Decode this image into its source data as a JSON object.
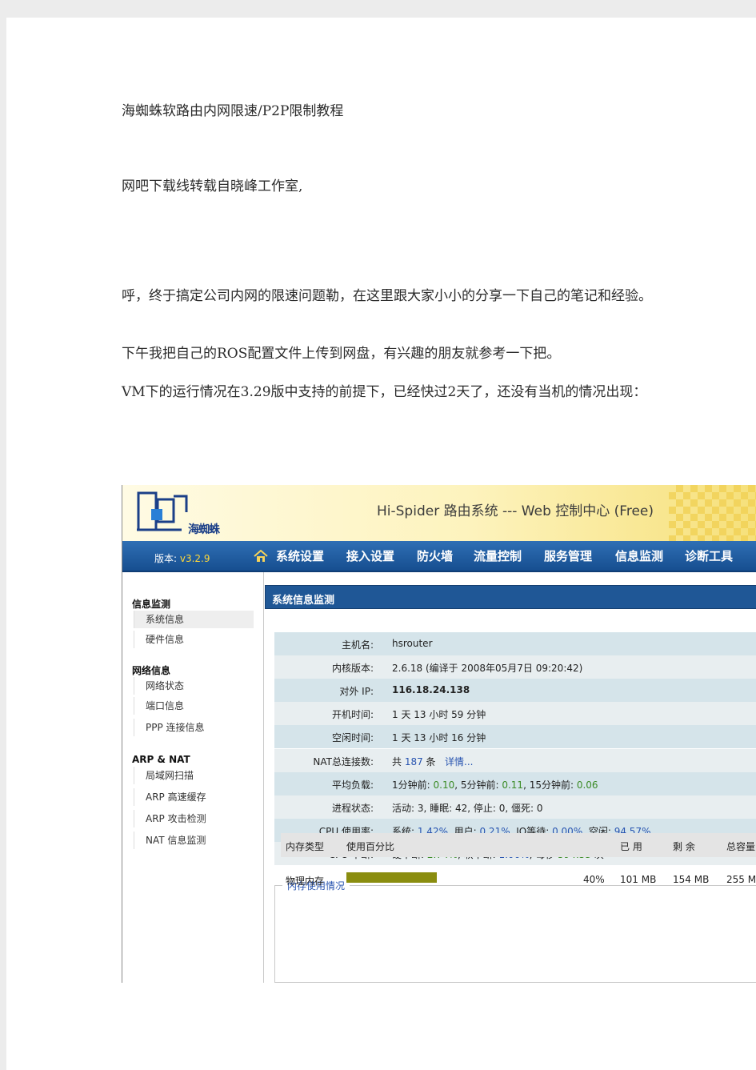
{
  "document": {
    "title": "海蜘蛛软路由内网限速/P2P限制教程",
    "source": "网吧下载线转载自晓峰工作室,",
    "para1": "呼，终于搞定公司内网的限速问题勒，在这里跟大家小小的分享一下自己的笔记和经验。",
    "para2": "下午我把自己的ROS配置文件上传到网盘，有兴趣的朋友就参考一下把。",
    "para3": "VM下的运行情况在3.29版中支持的前提下，已经快过2天了，还没有当机的情况出现："
  },
  "app": {
    "banner_title": "Hi-Spider 路由系统 --- Web 控制中心 (Free)",
    "logo_text": "海蜘蛛",
    "version_label": "版本: ",
    "version_value": "v3.2.9",
    "nav": [
      "系统设置",
      "接入设置",
      "防火墙",
      "流量控制",
      "服务管理",
      "信息监测",
      "诊断工具"
    ]
  },
  "sidebar": {
    "groups": [
      {
        "title": "信息监测",
        "items": [
          "系统信息",
          "硬件信息"
        ]
      },
      {
        "title": "网络信息",
        "items": [
          "网络状态",
          "端口信息",
          "PPP 连接信息"
        ]
      },
      {
        "title": "ARP & NAT",
        "items": [
          "局域网扫描",
          "ARP 高速缓存",
          "ARP 攻击检测",
          "NAT 信息监测"
        ]
      }
    ]
  },
  "panel": {
    "title": "系统信息监测",
    "hostname_label": "主机名:",
    "hostname": "hsrouter",
    "kernel_label": "内核版本:",
    "kernel": "2.6.18 (编译于  2008年05月7日  09:20:42)",
    "ip_label": "对外 IP:",
    "ip": "116.18.24.138",
    "boot_label": "开机时间:",
    "boot": "1 天  13 小时  59 分钟",
    "idle_label": "空闲时间:",
    "idle": "1 天  13 小时  16 分钟",
    "nat_label": "NAT总连接数:",
    "nat_prefix": "共 ",
    "nat_count": "187",
    "nat_suffix": " 条",
    "nat_detail": "详情...",
    "load_label": "平均负载:",
    "load_1_label": "1分钟前: ",
    "load_1": "0.10",
    "load_5_label": ", 5分钟前: ",
    "load_5": "0.11",
    "load_15_label": ", 15分钟前: ",
    "load_15": "0.06",
    "proc_label": "进程状态:",
    "proc": "活动: 3, 睡眠: 42, 停止: 0, 僵死: 0",
    "cpu_label": "CPU 使用率:",
    "cpu_sys_label": "系统: ",
    "cpu_sys": "1.42%",
    "cpu_user_label": ", 用户: ",
    "cpu_user": "0.21%",
    "cpu_io_label": ", IO等待: ",
    "cpu_io": "0.00%",
    "cpu_idle_label": ", 空闲: ",
    "cpu_idle": "94.57%",
    "irq_label": "CPU 中断:",
    "irq_hard_label": "硬中断: ",
    "irq_hard": "2.74%",
    "irq_soft_label": ", 软中断: ",
    "irq_soft": "1.06%",
    "irq_rate_label": ", 每秒 ",
    "irq_rate": "594.53",
    "irq_rate_suffix": " 次"
  },
  "memory": {
    "legend": "内存使用情况",
    "headers": [
      "内存类型",
      "使用百分比",
      "已 用",
      "剩 余",
      "总容量"
    ],
    "row": {
      "type": "物理内存",
      "percent": "40%",
      "used": "101 MB",
      "free": "154 MB",
      "total": "255 M"
    },
    "usage_fraction": 0.4,
    "bar_color": "#8a8d0f"
  }
}
